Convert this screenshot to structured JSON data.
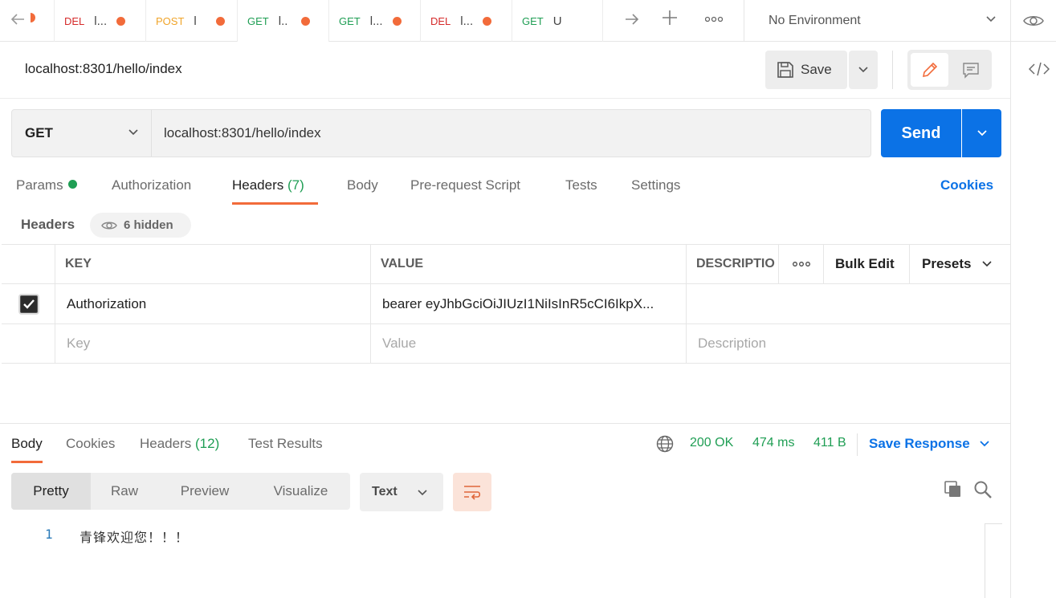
{
  "tabs": [
    {
      "method": "DEL",
      "name": "l...",
      "dirty": true
    },
    {
      "method": "POST",
      "name": "l",
      "dirty": true
    },
    {
      "method": "GET",
      "name": "l..",
      "dirty": true
    },
    {
      "method": "GET",
      "name": "l...",
      "dirty": true
    },
    {
      "method": "DEL",
      "name": "l...",
      "dirty": true
    },
    {
      "method": "GET",
      "name": "U",
      "dirty": false
    }
  ],
  "environment": {
    "selected": "No Environment"
  },
  "request": {
    "title": "localhost:8301/hello/index",
    "save_label": "Save",
    "method": "GET",
    "url": "localhost:8301/hello/index",
    "send_label": "Send"
  },
  "request_tabs": {
    "params": "Params",
    "authorization": "Authorization",
    "headers": "Headers",
    "headers_count": "(7)",
    "body": "Body",
    "prerequest": "Pre-request Script",
    "tests": "Tests",
    "settings": "Settings",
    "cookies": "Cookies"
  },
  "headers_section": {
    "label": "Headers",
    "hidden": "6 hidden",
    "columns": {
      "key": "KEY",
      "value": "VALUE",
      "description": "DESCRIPTIO",
      "bulk_edit": "Bulk Edit",
      "presets": "Presets"
    },
    "rows": [
      {
        "checked": true,
        "key": "Authorization",
        "value": "bearer eyJhbGciOiJIUzI1NiIsInR5cCI6IkpX...",
        "description": ""
      }
    ],
    "placeholders": {
      "key": "Key",
      "value": "Value",
      "description": "Description"
    }
  },
  "response": {
    "tabs": {
      "body": "Body",
      "cookies": "Cookies",
      "headers": "Headers",
      "headers_count": "(12)",
      "test_results": "Test Results"
    },
    "status": "200 OK",
    "time": "474 ms",
    "size": "411 B",
    "save_label": "Save Response",
    "views": [
      "Pretty",
      "Raw",
      "Preview",
      "Visualize"
    ],
    "format": "Text",
    "lines": [
      {
        "no": "1",
        "text": "青锋欢迎您！！！"
      }
    ]
  },
  "colors": {
    "accent": "#f26b3a",
    "send": "#0b72e6",
    "success": "#1f9e54",
    "delete": "#d52a2a",
    "post": "#f0a429"
  }
}
